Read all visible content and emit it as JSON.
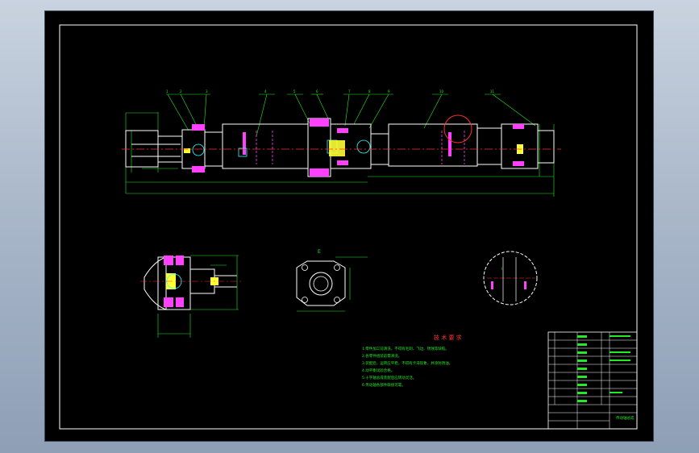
{
  "drawing": {
    "views": [
      "E",
      "I"
    ],
    "part_numbers": [
      "1",
      "2",
      "3",
      "4",
      "5",
      "6",
      "7",
      "8",
      "9",
      "10",
      "11"
    ],
    "tech_req": {
      "title": "技 术 要 求",
      "lines": [
        "1.零件加工前清洗，不得有毛刺、飞边、锈蚀等缺陷。",
        "2.各零件组装前需清洗。",
        "3.装配后，运转应平稳，不得有卡滞现象，并涂防锈油。",
        "4.动平衡试验合格。",
        "5.十字轴总成装配后应转动灵活。",
        "6.传动轴各部件联接可靠。"
      ]
    },
    "title_block": {
      "name": "传动轴总成"
    }
  },
  "colors": {
    "frame": "#ffffff",
    "line": "#ffffff",
    "centerline": "#ff3030",
    "dimension": "#27e827",
    "hatch": "#ff40ff",
    "cyan": "#33ffff",
    "yellow": "#ffff33",
    "text": "#27e827"
  }
}
